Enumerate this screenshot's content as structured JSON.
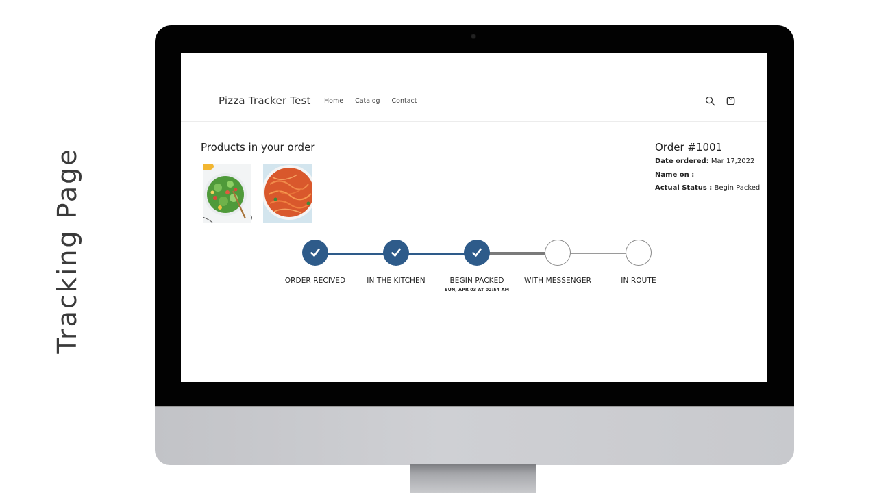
{
  "slide_title": "Tracking Page",
  "store": {
    "brand": "Pizza Tracker Test",
    "nav": [
      {
        "label": "Home"
      },
      {
        "label": "Catalog"
      },
      {
        "label": "Contact"
      }
    ],
    "icons": {
      "search": "search-icon",
      "cart": "cart-icon"
    }
  },
  "products": {
    "title": "Products in your order",
    "items": [
      {
        "name": "Salad",
        "image": "salad-bowl"
      },
      {
        "name": "Spaghetti",
        "image": "spaghetti-pan"
      }
    ],
    "stray_text": ")"
  },
  "order": {
    "title": "Order #1001",
    "date_label": "Date ordered:",
    "date_value": "Mar 17,2022",
    "name_label": "Name on :",
    "name_value": "",
    "status_label": "Actual Status :",
    "status_value": "Begin Packed"
  },
  "tracker": {
    "accent_color": "#2e5b8a",
    "pending_color": "#8a8a8a",
    "completed_steps": 3,
    "steps": [
      {
        "label": "ORDER RECIVED",
        "status": "done",
        "time": ""
      },
      {
        "label": "IN THE KITCHEN",
        "status": "done",
        "time": ""
      },
      {
        "label": "BEGIN PACKED",
        "status": "done",
        "time": "SUN, APR 03 AT 02:54 AM"
      },
      {
        "label": "WITH MESSENGER",
        "status": "pending",
        "time": ""
      },
      {
        "label": "IN ROUTE",
        "status": "pending",
        "time": ""
      }
    ]
  }
}
